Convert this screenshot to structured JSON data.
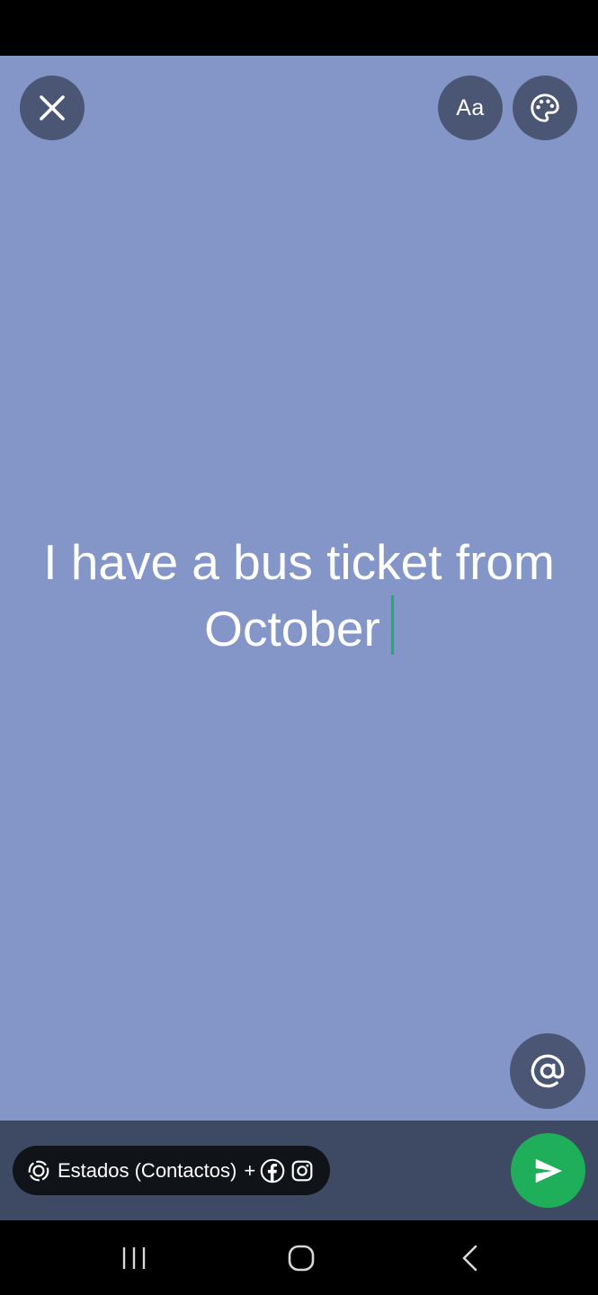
{
  "canvas": {
    "background_color": "#8496c8",
    "status_text": "I have a bus ticket from October",
    "caret_color": "#1fae6a"
  },
  "toolbar": {
    "close_icon": "close-icon",
    "font_label": "Aa",
    "palette_icon": "palette-icon"
  },
  "mention": {
    "icon": "at-sign-icon"
  },
  "audience": {
    "label": "Estados (Contactos)",
    "plus": "+",
    "icons": [
      "status-icon",
      "facebook-icon",
      "instagram-icon"
    ]
  },
  "send": {
    "icon": "send-icon",
    "color": "#1fae5a"
  },
  "nav": {
    "buttons": [
      "recents-icon",
      "home-icon",
      "back-icon"
    ]
  }
}
